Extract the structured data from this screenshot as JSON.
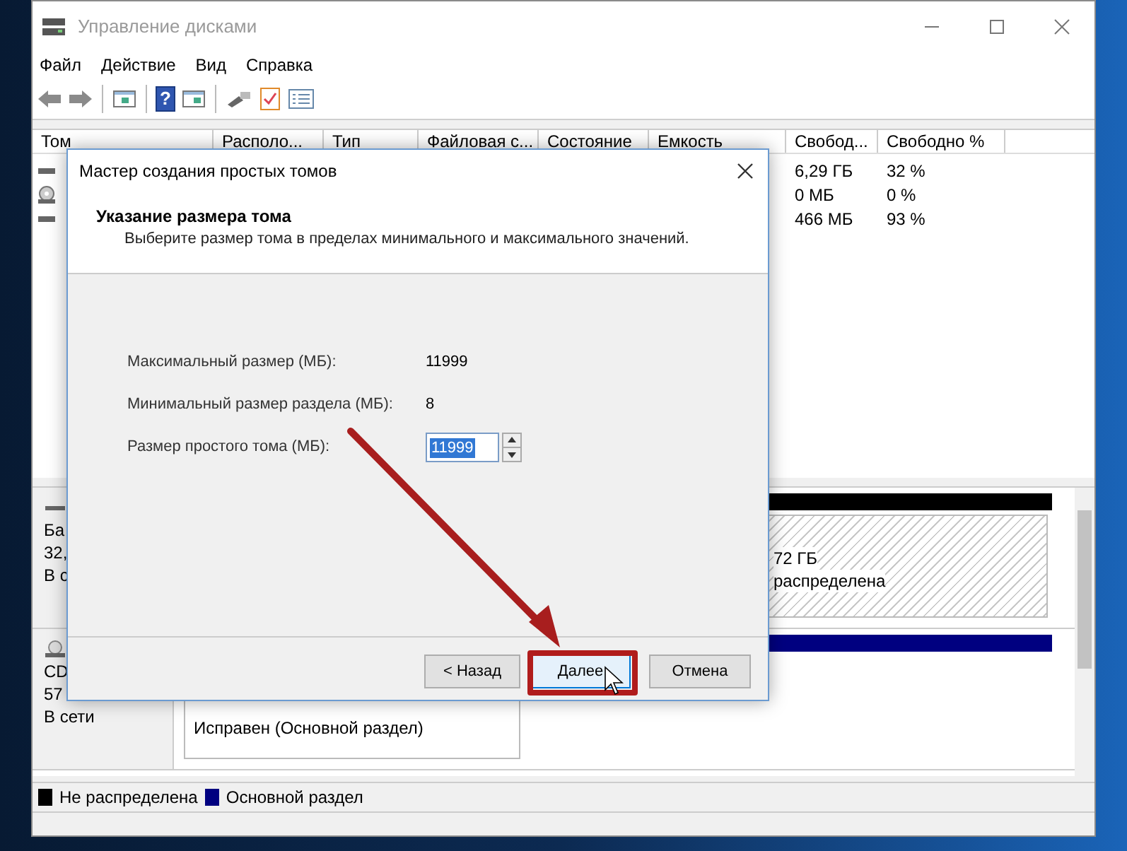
{
  "window": {
    "title": "Управление дисками"
  },
  "menu": [
    "Файл",
    "Действие",
    "Вид",
    "Справка"
  ],
  "toolbar": [
    {
      "kind": "back"
    },
    {
      "kind": "forward"
    },
    {
      "kind": "separator"
    },
    {
      "kind": "panel"
    },
    {
      "kind": "separator"
    },
    {
      "kind": "help",
      "glyph": "?"
    },
    {
      "kind": "panel2"
    },
    {
      "kind": "separator"
    },
    {
      "kind": "key"
    },
    {
      "kind": "check"
    },
    {
      "kind": "list"
    }
  ],
  "volume_table": {
    "columns": [
      "Том",
      "Располо...",
      "Тип",
      "Файловая с...",
      "Состояние",
      "Емкость",
      "Свобод...",
      "Свободно %"
    ],
    "rows": [
      {
        "kind": "disk",
        "free": "6,29 ГБ",
        "free_percent": "32 %"
      },
      {
        "kind": "cd",
        "free": "0 МБ",
        "free_percent": "0 %"
      },
      {
        "kind": "disk",
        "free": "466 МБ",
        "free_percent": "93 %"
      }
    ]
  },
  "disks": [
    {
      "kind": "disk",
      "label_lines": [
        "Ба",
        "32,",
        "В с"
      ],
      "partition": {
        "kind": "unallocated",
        "lines": [
          "72 ГБ",
          "распределена"
        ]
      }
    },
    {
      "kind": "cd",
      "label_lines": [
        "CD",
        "57",
        "В сети"
      ],
      "partition": {
        "kind": "primary",
        "lines": [
          "Исправен (Основной раздел)"
        ]
      }
    }
  ],
  "legend": [
    {
      "label": "Не распределена",
      "color": "#000000"
    },
    {
      "label": "Основной раздел",
      "color": "#000080"
    }
  ],
  "dialog": {
    "title": "Мастер создания простых томов",
    "heading": "Указание размера тома",
    "description": "Выберите размер тома в пределах минимального и максимального значений.",
    "fields": [
      {
        "kind": "readonly",
        "label": "Максимальный размер (МБ):",
        "value": "11999"
      },
      {
        "kind": "readonly",
        "label": "Минимальный размер раздела (МБ):",
        "value": "8"
      },
      {
        "kind": "spin",
        "label": "Размер простого тома (МБ):",
        "value": "11999"
      }
    ],
    "buttons": [
      {
        "label": "< Назад",
        "highlighted": false
      },
      {
        "label": "Далее",
        "highlighted": true
      },
      {
        "label": "Отмена",
        "highlighted": false
      }
    ]
  }
}
